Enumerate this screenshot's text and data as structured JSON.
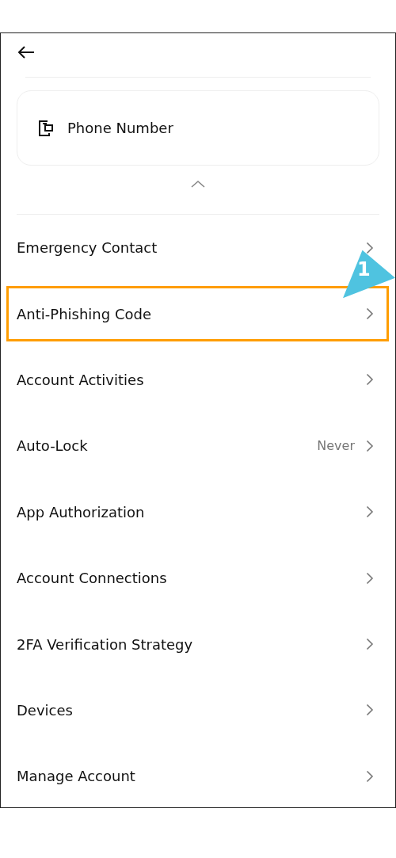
{
  "card": {
    "label": "Phone Number"
  },
  "items": [
    {
      "label": "Emergency Contact",
      "highlighted": false
    },
    {
      "label": "Anti-Phishing Code",
      "highlighted": true
    },
    {
      "label": "Account Activities",
      "highlighted": false
    },
    {
      "label": "Auto-Lock",
      "value": "Never",
      "highlighted": false
    },
    {
      "label": "App Authorization",
      "highlighted": false
    },
    {
      "label": "Account Connections",
      "highlighted": false
    },
    {
      "label": "2FA Verification Strategy",
      "highlighted": false
    },
    {
      "label": "Devices",
      "highlighted": false
    },
    {
      "label": "Manage Account",
      "highlighted": false
    }
  ],
  "callout": {
    "label": "1"
  }
}
